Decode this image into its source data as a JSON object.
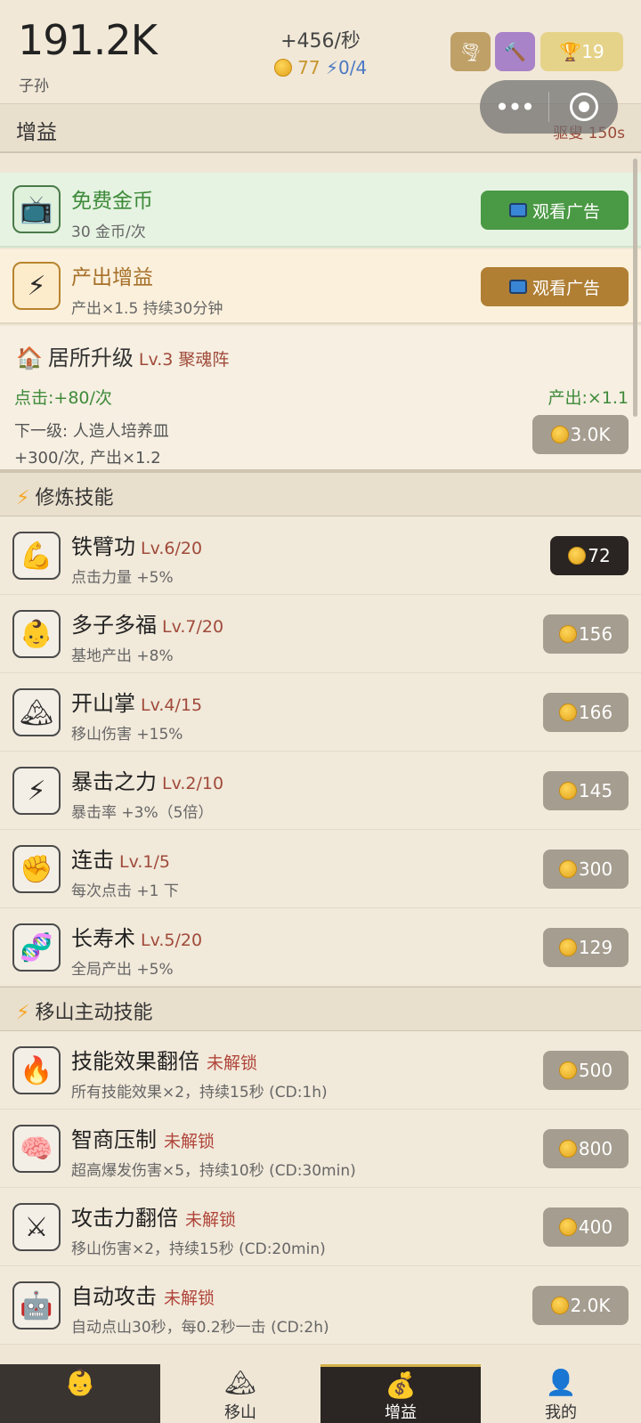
{
  "header": {
    "population": "191.2K",
    "population_label": "子孙",
    "rate": "+456/秒",
    "gold": "77",
    "energy": "0/4",
    "trophy_count": "19"
  },
  "capsule": {
    "more_icon": "•••",
    "target_icon": "target"
  },
  "section_header": {
    "title": "增益",
    "boss_timer": "驱叟 150s"
  },
  "ads": [
    {
      "title": "免费金币",
      "desc": "30 金币/次",
      "button": "观看广告"
    },
    {
      "title": "产出增益",
      "desc": "产出×1.5 持续30分钟",
      "button": "观看广告"
    }
  ],
  "home": {
    "title": "居所升级",
    "level": "Lv.3 聚魂阵",
    "click": "点击:+80/次",
    "output": "产出:×1.1",
    "next": "下一级: 人造人培养皿",
    "next_effect": "+300/次, 产出×1.2",
    "cost": "3.0K"
  },
  "skills_section": {
    "title": "修炼技能"
  },
  "skills": [
    {
      "icon": "💪",
      "name": "铁臂功",
      "level": "Lv.6/20",
      "desc": "点击力量 +5%",
      "cost": "72"
    },
    {
      "icon": "👶",
      "name": "多子多福",
      "level": "Lv.7/20",
      "desc": "基地产出 +8%",
      "cost": "156"
    },
    {
      "icon": "🏔",
      "name": "开山掌",
      "level": "Lv.4/15",
      "desc": "移山伤害 +15%",
      "cost": "166"
    },
    {
      "icon": "⚡",
      "name": "暴击之力",
      "level": "Lv.2/10",
      "desc": "暴击率 +3%（5倍）",
      "cost": "145"
    },
    {
      "icon": "✊",
      "name": "连击",
      "level": "Lv.1/5",
      "desc": "每次点击 +1 下",
      "cost": "300"
    },
    {
      "icon": "🧬",
      "name": "长寿术",
      "level": "Lv.5/20",
      "desc": "全局产出 +5%",
      "cost": "129"
    }
  ],
  "active_section": {
    "title": "移山主动技能"
  },
  "active": [
    {
      "icon": "🔥",
      "name": "技能效果翻倍",
      "status": "未解锁",
      "desc": "所有技能效果×2，持续15秒 (CD:1h)",
      "cost": "500"
    },
    {
      "icon": "🧠",
      "name": "智商压制",
      "status": "未解锁",
      "desc": "超高爆发伤害×5，持续10秒 (CD:30min)",
      "cost": "800"
    },
    {
      "icon": "⚔",
      "name": "攻击力翻倍",
      "status": "未解锁",
      "desc": "移山伤害×2，持续15秒 (CD:20min)",
      "cost": "400"
    },
    {
      "icon": "🤖",
      "name": "自动攻击",
      "status": "未解锁",
      "desc": "自动点山30秒，每0.2秒一击 (CD:2h)",
      "cost": "2.0K"
    }
  ],
  "nav": [
    {
      "icon": "👶",
      "label": ""
    },
    {
      "icon": "🏔",
      "label": "移山"
    },
    {
      "icon": "💰",
      "label": "增益"
    },
    {
      "icon": "👤",
      "label": "我的"
    }
  ],
  "colors": {
    "accent_green": "#4a9944",
    "accent_gold": "#b07f34",
    "level_red": "#a04a3a"
  }
}
